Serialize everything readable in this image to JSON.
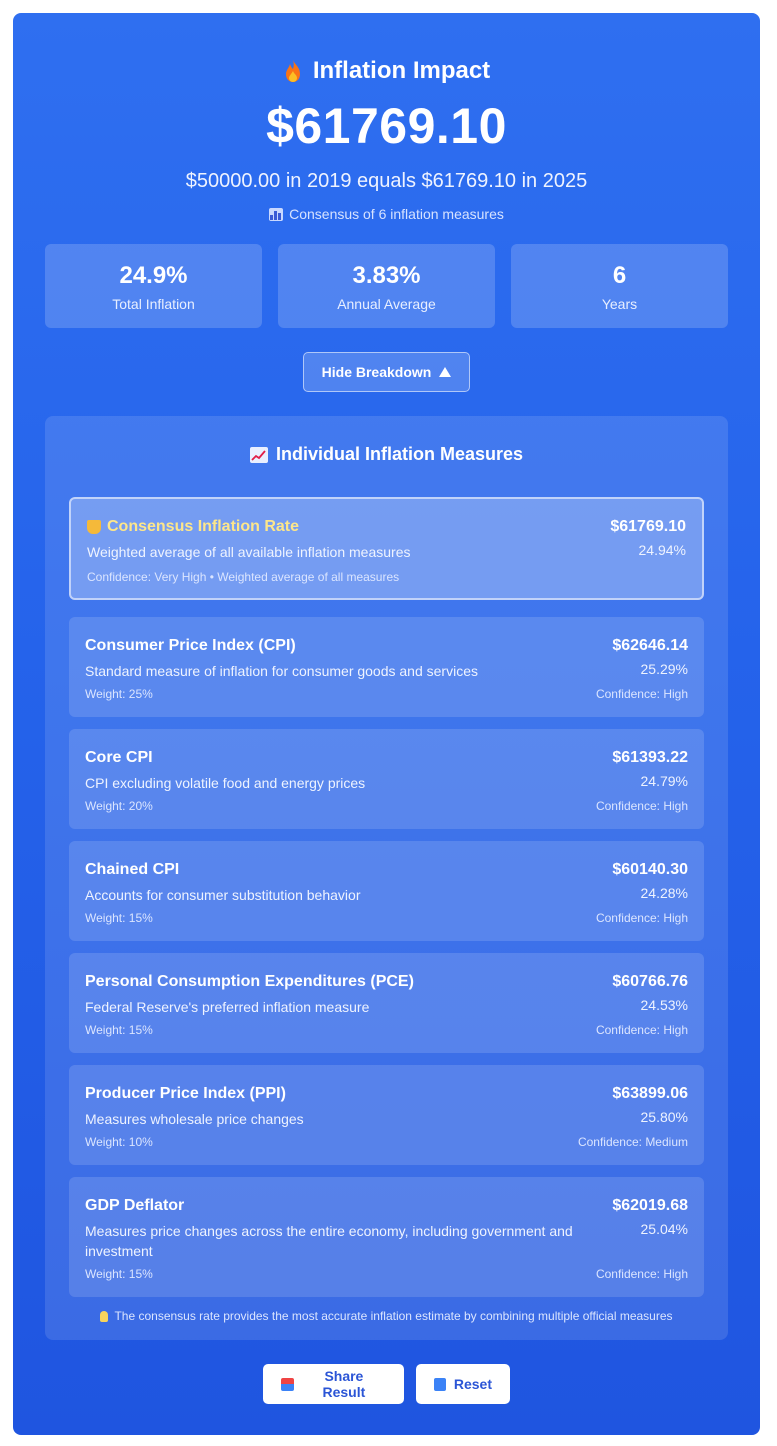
{
  "hero": {
    "title": "Inflation Impact",
    "title_icon": "flame-icon",
    "amount": "$61769.10",
    "equals": "$50000.00 in 2019 equals $61769.10 in 2025",
    "consensus_note": "Consensus of 6 inflation measures"
  },
  "stats": [
    {
      "value": "24.9%",
      "label": "Total Inflation"
    },
    {
      "value": "3.83%",
      "label": "Annual Average"
    },
    {
      "value": "6",
      "label": "Years"
    }
  ],
  "toggle": {
    "label": "Hide Breakdown"
  },
  "panel": {
    "title": "Individual Inflation Measures",
    "consensus": {
      "name": "Consensus Inflation Rate",
      "desc": "Weighted average of all available inflation measures",
      "meta": "Confidence: Very High • Weighted average of all measures",
      "value": "$61769.10",
      "pct": "24.94%"
    },
    "measures": [
      {
        "name": "Consumer Price Index (CPI)",
        "desc": "Standard measure of inflation for consumer goods and services",
        "value": "$62646.14",
        "pct": "25.29%",
        "weight": "Weight: 25%",
        "confidence": "Confidence: High"
      },
      {
        "name": "Core CPI",
        "desc": "CPI excluding volatile food and energy prices",
        "value": "$61393.22",
        "pct": "24.79%",
        "weight": "Weight: 20%",
        "confidence": "Confidence: High"
      },
      {
        "name": "Chained CPI",
        "desc": "Accounts for consumer substitution behavior",
        "value": "$60140.30",
        "pct": "24.28%",
        "weight": "Weight: 15%",
        "confidence": "Confidence: High"
      },
      {
        "name": "Personal Consumption Expenditures (PCE)",
        "desc": "Federal Reserve's preferred inflation measure",
        "value": "$60766.76",
        "pct": "24.53%",
        "weight": "Weight: 15%",
        "confidence": "Confidence: High"
      },
      {
        "name": "Producer Price Index (PPI)",
        "desc": "Measures wholesale price changes",
        "value": "$63899.06",
        "pct": "25.80%",
        "weight": "Weight: 10%",
        "confidence": "Confidence: Medium"
      },
      {
        "name": "GDP Deflator",
        "desc": "Measures price changes across the entire economy, including government and investment",
        "value": "$62019.68",
        "pct": "25.04%",
        "weight": "Weight: 15%",
        "confidence": "Confidence: High"
      }
    ],
    "footnote": "The consensus rate provides the most accurate inflation estimate by combining multiple official measures"
  },
  "actions": {
    "share_label": "Share Result",
    "reset_label": "Reset"
  },
  "colors": {
    "background_top": "#2f6ff0",
    "background_bottom": "#1f55e0",
    "consensus_accent": "#fde68a",
    "button_text": "#2b55d6"
  }
}
